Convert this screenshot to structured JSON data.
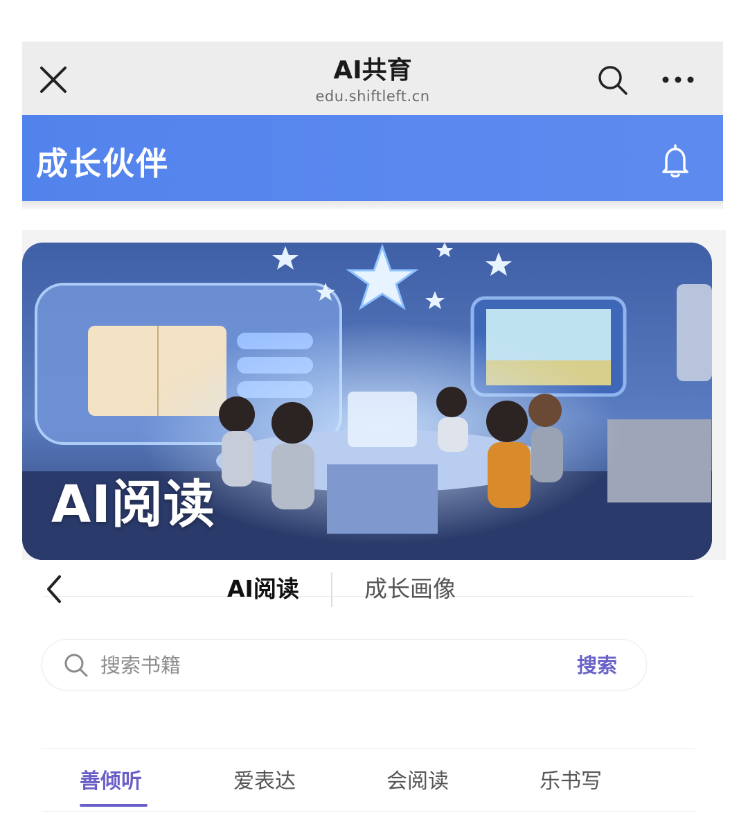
{
  "browser": {
    "title": "AI共育",
    "url": "edu.shiftleft.cn",
    "icons": [
      "close-icon",
      "search-icon",
      "more-icon"
    ]
  },
  "app_header": {
    "title": "成长伙伴",
    "icon": "bell-icon",
    "color": "#5585ED"
  },
  "banner": {
    "caption": "AI阅读"
  },
  "nav": {
    "back_icon": "chevron-left-icon",
    "tabs": [
      {
        "label": "AI阅读",
        "active": true
      },
      {
        "label": "成长画像",
        "active": false
      }
    ]
  },
  "search": {
    "placeholder": "搜索书籍",
    "value": "",
    "button_label": "搜索"
  },
  "categories": [
    {
      "label": "善倾听",
      "active": true
    },
    {
      "label": "爱表达",
      "active": false
    },
    {
      "label": "会阅读",
      "active": false
    },
    {
      "label": "乐书写",
      "active": false
    }
  ],
  "colors": {
    "accent": "#6A5FC8",
    "header_blue": "#5585ED"
  }
}
